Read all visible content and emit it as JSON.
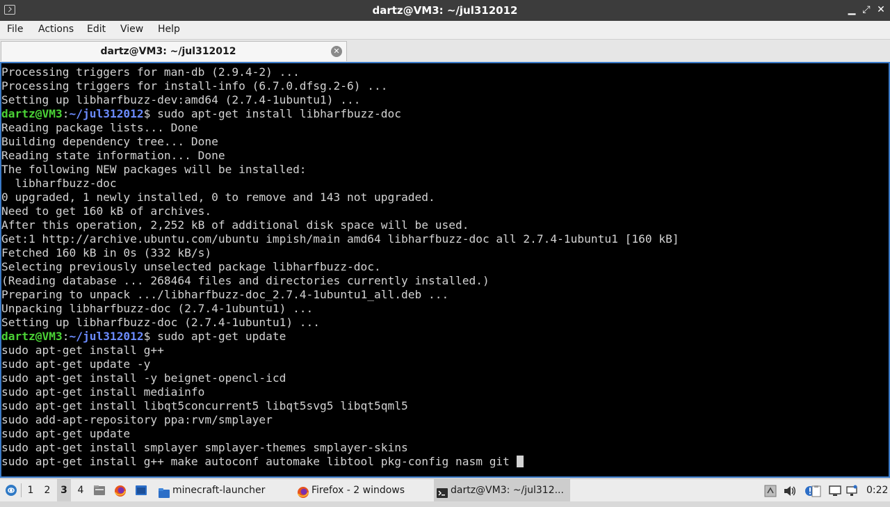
{
  "window": {
    "title": "dartz@VM3: ~/jul312012"
  },
  "menu": [
    "File",
    "Actions",
    "Edit",
    "View",
    "Help"
  ],
  "tab": {
    "label": "dartz@VM3: ~/jul312012",
    "close_symbol": "✕"
  },
  "prompt": {
    "user": "dartz@VM3",
    "path": "~/jul312012",
    "sep": ":",
    "dollar": "$"
  },
  "terminal_lines": [
    {
      "t": "Processing triggers for man-db (2.9.4-2) ..."
    },
    {
      "t": "Processing triggers for install-info (6.7.0.dfsg.2-6) ..."
    },
    {
      "t": "Setting up libharfbuzz-dev:amd64 (2.7.4-1ubuntu1) ..."
    },
    {
      "prompt": true,
      "t": " sudo apt-get install libharfbuzz-doc"
    },
    {
      "t": "Reading package lists... Done"
    },
    {
      "t": "Building dependency tree... Done"
    },
    {
      "t": "Reading state information... Done"
    },
    {
      "t": "The following NEW packages will be installed:"
    },
    {
      "t": "  libharfbuzz-doc"
    },
    {
      "t": "0 upgraded, 1 newly installed, 0 to remove and 143 not upgraded."
    },
    {
      "t": "Need to get 160 kB of archives."
    },
    {
      "t": "After this operation, 2,252 kB of additional disk space will be used."
    },
    {
      "t": "Get:1 http://archive.ubuntu.com/ubuntu impish/main amd64 libharfbuzz-doc all 2.7.4-1ubuntu1 [160 kB]"
    },
    {
      "t": "Fetched 160 kB in 0s (332 kB/s)"
    },
    {
      "t": "Selecting previously unselected package libharfbuzz-doc."
    },
    {
      "t": "(Reading database ... 268464 files and directories currently installed.)"
    },
    {
      "t": "Preparing to unpack .../libharfbuzz-doc_2.7.4-1ubuntu1_all.deb ..."
    },
    {
      "t": "Unpacking libharfbuzz-doc (2.7.4-1ubuntu1) ..."
    },
    {
      "t": "Setting up libharfbuzz-doc (2.7.4-1ubuntu1) ..."
    },
    {
      "prompt": true,
      "t": " sudo apt-get update"
    },
    {
      "t": "sudo apt-get install g++"
    },
    {
      "t": "sudo apt-get update -y"
    },
    {
      "t": "sudo apt-get install -y beignet-opencl-icd"
    },
    {
      "t": "sudo apt-get install mediainfo"
    },
    {
      "t": "sudo apt-get install libqt5concurrent5 libqt5svg5 libqt5qml5"
    },
    {
      "t": "sudo add-apt-repository ppa:rvm/smplayer"
    },
    {
      "t": "sudo apt-get update"
    },
    {
      "t": "sudo apt-get install smplayer smplayer-themes smplayer-skins"
    },
    {
      "t": "sudo apt-get install g++ make autoconf automake libtool pkg-config nasm git ",
      "cursor": true
    }
  ],
  "taskbar": {
    "workspaces": [
      "1",
      "2",
      "3",
      "4"
    ],
    "active_workspace": "3",
    "tasks": [
      {
        "label": "minecraft-launcher",
        "icon": "folder-icon"
      },
      {
        "label": "Firefox - 2 windows",
        "icon": "firefox-icon"
      },
      {
        "label": "dartz@VM3: ~/jul312...",
        "icon": "terminal-icon"
      }
    ],
    "clock": "0:22"
  },
  "colors": {
    "prompt_user": "#4bd336",
    "prompt_path": "#6c8cff",
    "terminal_bg": "#000000",
    "terminal_fg": "#d3d3d3"
  }
}
